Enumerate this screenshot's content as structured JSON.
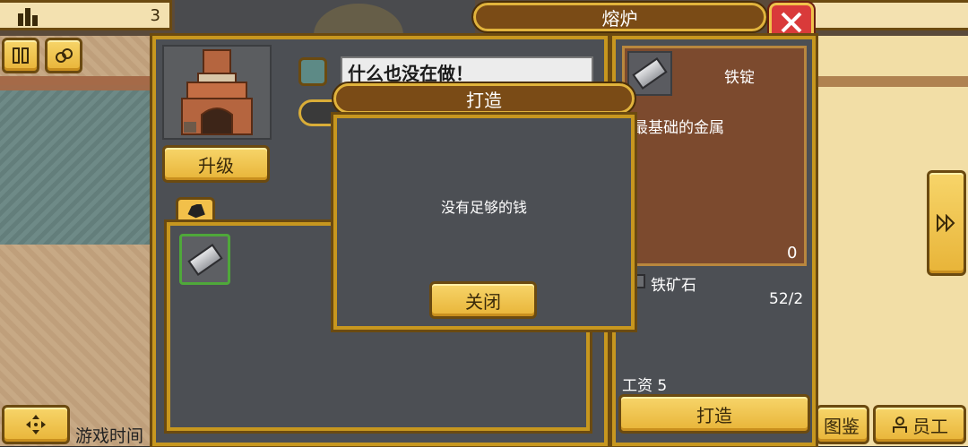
{
  "hud": {
    "top_left_count": "3",
    "bottom_left_label": "游戏时间"
  },
  "window": {
    "title": "熔炉",
    "upgrade_label": "升级",
    "status_text": "什么也没在做！"
  },
  "item_info": {
    "name": "铁锭",
    "description": "最基础的金属",
    "owned": "0",
    "material_name": "铁矿石",
    "material_count": "52/2",
    "wage_label": "工资 5",
    "craft_label": "打造"
  },
  "dialog": {
    "title": "打造",
    "message": "没有足够的钱",
    "close_label": "关闭"
  },
  "bottom_nav": {
    "codex_label": "图鉴",
    "staff_label": "员工"
  },
  "colors": {
    "gold": "#e8b438",
    "brown_title": "#7a4b16",
    "panel_gray": "#4c4f54",
    "close_red": "#d93a3a",
    "card_brown": "#7c4a2e"
  }
}
